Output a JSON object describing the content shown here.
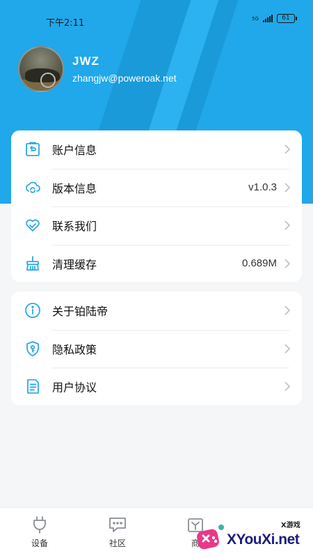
{
  "status_bar": {
    "time": "下午2:11",
    "network": "5G",
    "battery": "61"
  },
  "profile": {
    "name": "JWZ",
    "email": "zhangjw@poweroak.net"
  },
  "menu_group_1": [
    {
      "label": "账户信息",
      "value": "",
      "icon": "account-icon"
    },
    {
      "label": "版本信息",
      "value": "v1.0.3",
      "icon": "version-icon"
    },
    {
      "label": "联系我们",
      "value": "",
      "icon": "contact-icon"
    },
    {
      "label": "清理缓存",
      "value": "0.689M",
      "icon": "clean-cache-icon"
    }
  ],
  "menu_group_2": [
    {
      "label": "关于铂陆帝",
      "value": "",
      "icon": "info-icon"
    },
    {
      "label": "隐私政策",
      "value": "",
      "icon": "privacy-icon"
    },
    {
      "label": "用户协议",
      "value": "",
      "icon": "agreement-icon"
    }
  ],
  "tabs": [
    {
      "label": "设备",
      "icon": "plug-icon"
    },
    {
      "label": "社区",
      "icon": "chat-icon"
    },
    {
      "label": "商",
      "icon": "shop-icon"
    }
  ],
  "watermark": {
    "text": "XYouXi.net",
    "sub": "X游戏"
  },
  "colors": {
    "header_blue": "#20a8ea",
    "icon_blue": "#2aa9e6",
    "background": "#f4f6f7"
  }
}
